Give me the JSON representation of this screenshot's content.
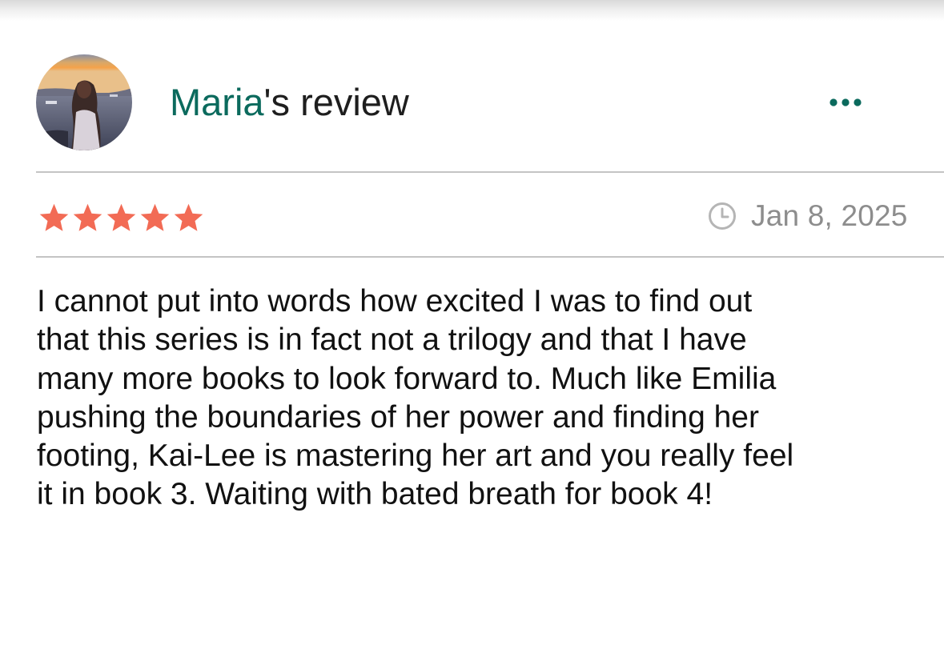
{
  "review": {
    "author": "Maria",
    "title_suffix": "'s review",
    "rating": 5,
    "rating_max": 5,
    "date": "Jan 8, 2025",
    "body_lines": [
      "I cannot put into words how excited I was to find out",
      "that this series is in fact not a trilogy and that I have",
      "many more books to look forward to. Much like Emilia",
      "pushing the boundaries of her power and finding her",
      "footing, Kai-Lee is mastering her art and you really feel",
      "it in book 3. Waiting with bated breath for book 4!"
    ]
  },
  "icons": {
    "more": "more-horizontal-icon",
    "clock": "clock-icon",
    "star": "star-icon",
    "avatar": "user-avatar"
  },
  "colors": {
    "author_name": "#0b6a5d",
    "more_dots": "#0b6a5d",
    "star": "#f26b55",
    "date_text": "#8d8d8d",
    "divider": "#c4c4c4",
    "body_text": "#111111"
  }
}
